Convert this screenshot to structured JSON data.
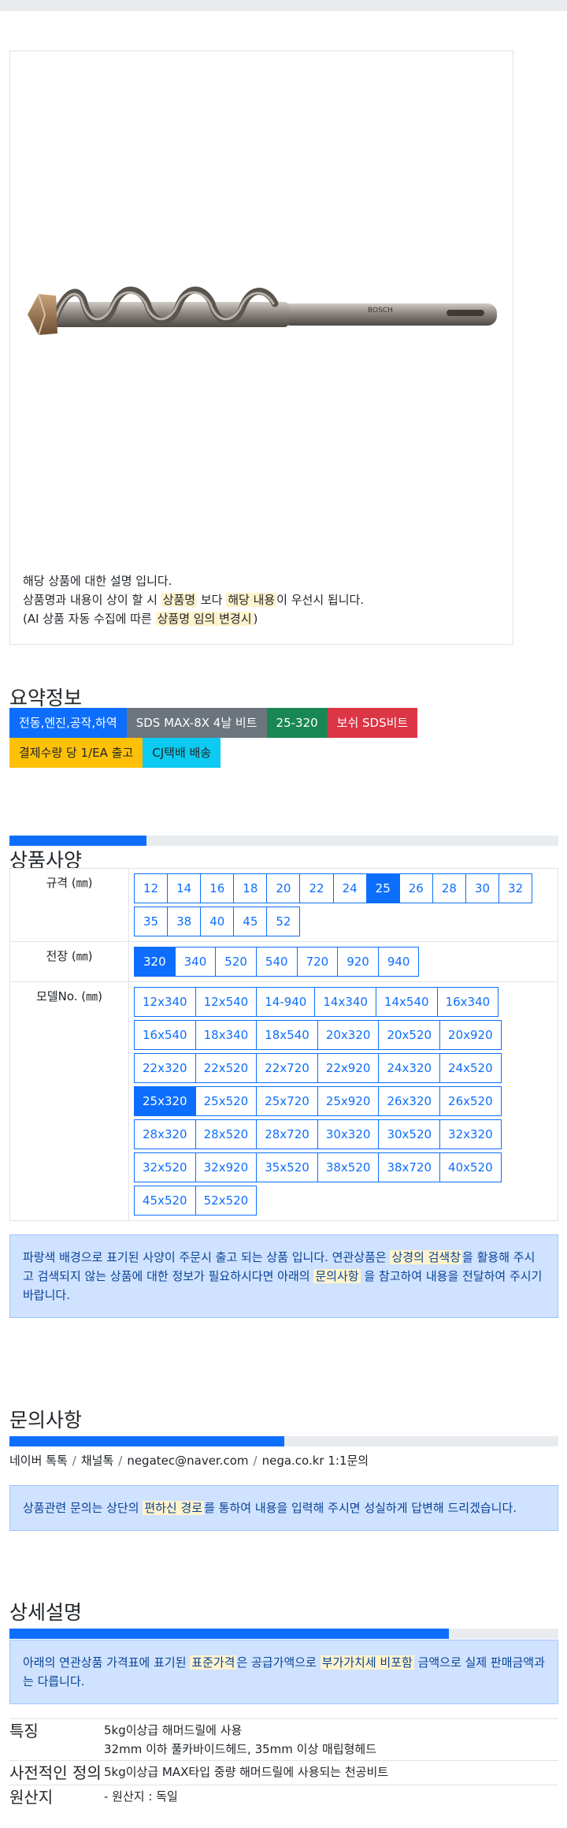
{
  "product": {
    "image_name": "bosch-sds-max-drill-bit",
    "brand_text": "BOSCH",
    "desc_line1": "해당 상품에 대한 설명 입니다.",
    "desc_line2_a": "상품명과 내용이 상이 할 시 ",
    "desc_line2_hl1": "상품명",
    "desc_line2_b": " 보다 ",
    "desc_line2_hl2": "해당 내용",
    "desc_line2_c": "이 우선시 됩니다.",
    "desc_line3_a": "(AI 상품 자동 수집에 따른 ",
    "desc_line3_hl": "상품명 임의 변경시",
    "desc_line3_b": ")"
  },
  "summary": {
    "title": "요약정보",
    "badges": [
      {
        "label": "전동,엔진,공작,하역",
        "color": "#0d6efd"
      },
      {
        "label": "SDS MAX-8X 4날 비트",
        "color": "#6c757d"
      },
      {
        "label": "25-320",
        "color": "#198754"
      },
      {
        "label": "보쉬 SDS비트",
        "color": "#dc3545"
      },
      {
        "label": "결제수량 당 1/EA 출고",
        "color": "#ffc107"
      },
      {
        "label": "CJ택배 배송",
        "color": "#0dcaf0"
      }
    ]
  },
  "spec": {
    "progress": 0.25,
    "title": "상품사양",
    "size_label": "규격 (㎜)",
    "sizes": [
      "12",
      "14",
      "16",
      "18",
      "20",
      "22",
      "24",
      "25",
      "26",
      "28",
      "30",
      "32",
      "35",
      "38",
      "40",
      "45",
      "52"
    ],
    "size_selected": "25",
    "length_label": "전장 (㎜)",
    "lengths": [
      "320",
      "340",
      "520",
      "540",
      "720",
      "920",
      "940"
    ],
    "length_selected": "320",
    "model_label": "모델No. (㎜)",
    "models": [
      "12x340",
      "12x540",
      "14-940",
      "14x340",
      "14x540",
      "16x340",
      "16x540",
      "18x340",
      "18x540",
      "20x320",
      "20x520",
      "20x920",
      "22x320",
      "22x520",
      "22x720",
      "22x920",
      "24x320",
      "24x520",
      "25x320",
      "25x520",
      "25x720",
      "25x920",
      "26x320",
      "26x520",
      "28x320",
      "28x520",
      "28x720",
      "30x320",
      "30x520",
      "32x320",
      "32x520",
      "32x920",
      "35x520",
      "38x520",
      "38x720",
      "40x520",
      "45x520",
      "52x520"
    ],
    "model_selected": "25x320",
    "notice_a": "파랑색 배경으로 표기된 사양이 주문시 출고 되는 상품 입니다. 연관상품은 ",
    "notice_hl1": "상경의 검색창",
    "notice_b": "을 활용해 주시고 검색되지 않는 상품에 대한 정보가 필요하시다면 아래의 ",
    "notice_hl2": "문의사항",
    "notice_c": " 을 참고하여 내용을 전달하여 주시기 바랍니다."
  },
  "inquiry": {
    "title": "문의사항",
    "progress": 0.5,
    "links": [
      "네이버 톡톡",
      "채널톡",
      "negatec@naver.com",
      "nega.co.kr 1:1문의"
    ],
    "separator": "/",
    "notice_a": "상품관련 문의는 상단의 ",
    "notice_hl": "편하신 경로",
    "notice_b": "를 통하여 내용을 입력해 주시면 성실하게 답변해 드리겠습니다."
  },
  "detail": {
    "title": "상세설명",
    "progress": 0.8,
    "notice_a": "아래의 연관상품 가격표에 표기된 ",
    "notice_hl1": "표준가격",
    "notice_b": "은 공급가액으로 ",
    "notice_hl2": "부가가치세 비포함",
    "notice_c": " 금액으로 실제 판매금액과는 다릅니다.",
    "rows": [
      {
        "key": "특징",
        "values": [
          "5kg이상급 해머드릴에 사용",
          "32mm 이하 풀카바이드헤드, 35mm 이상 매립형헤드"
        ]
      },
      {
        "key": "사전적인 정의",
        "values": [
          "5kg이상급 MAX타입 중량 해머드릴에 사용되는 천공비트"
        ]
      },
      {
        "key": "원산지",
        "values": [
          "- 원산지 : 독일"
        ]
      }
    ]
  }
}
